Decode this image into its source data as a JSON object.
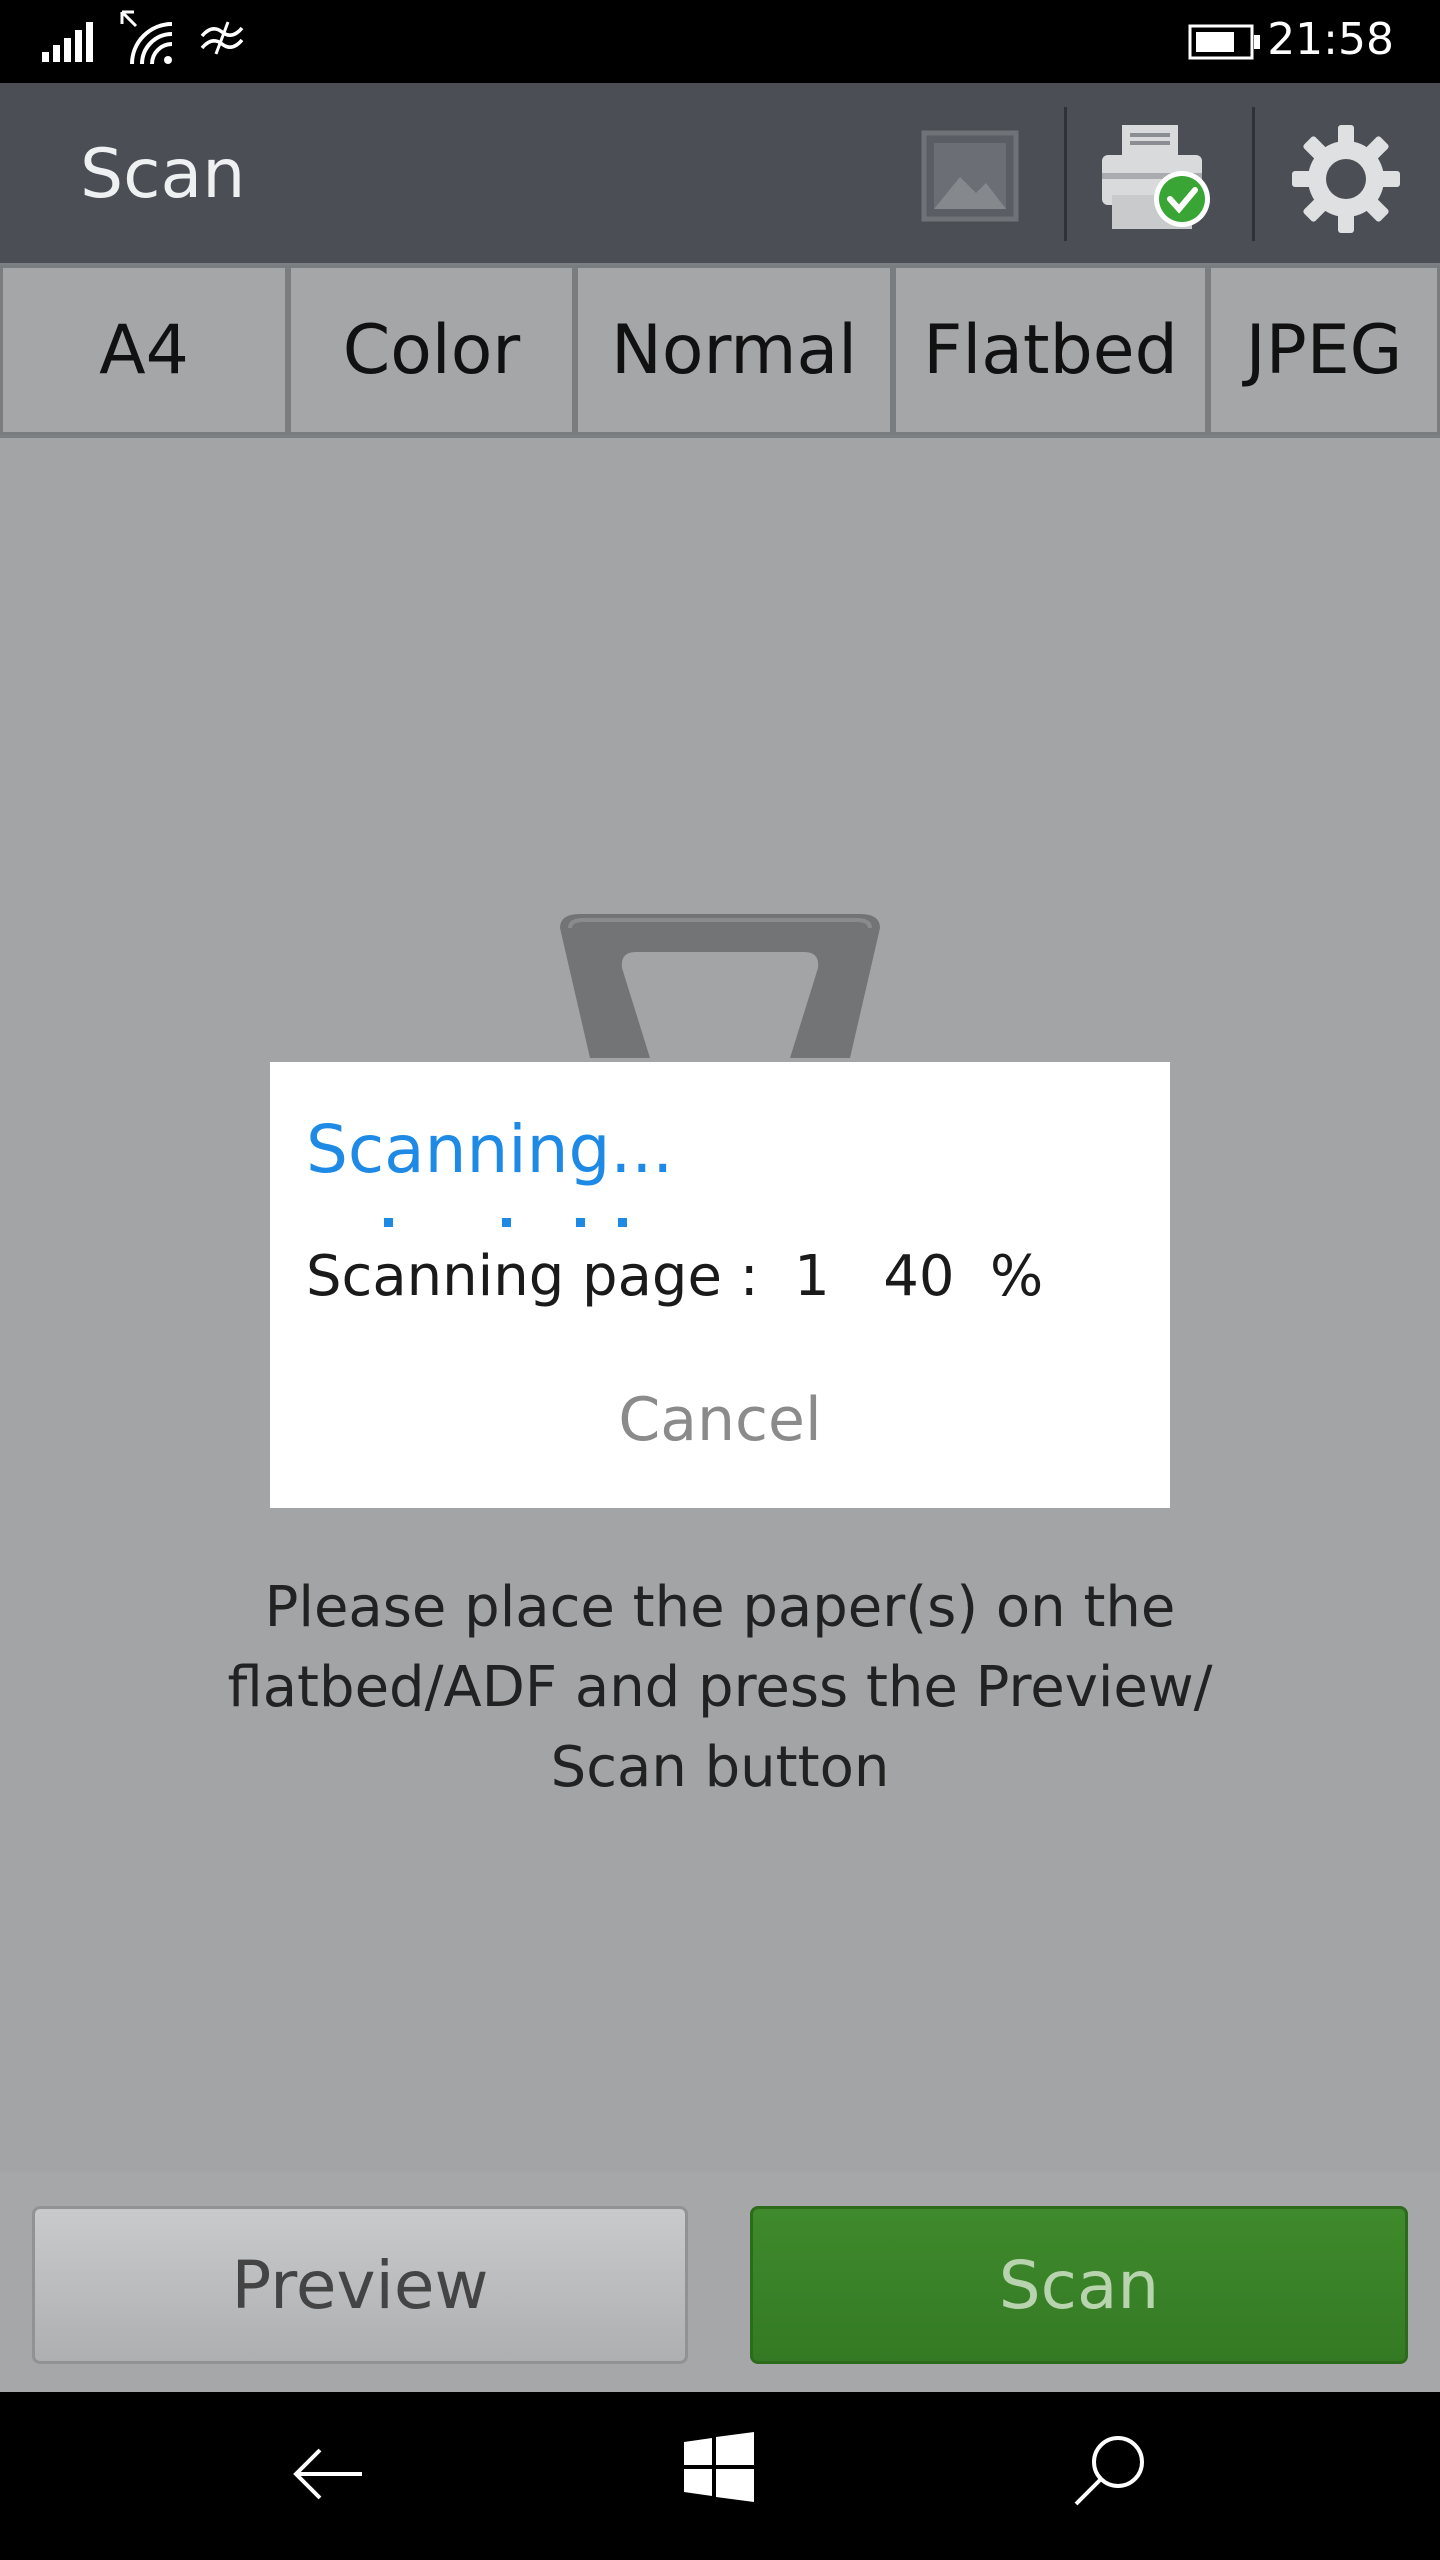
{
  "status_bar": {
    "time": "21:58",
    "icons": [
      "signal-icon",
      "wifi-icon",
      "wifi-calling-icon",
      "battery-icon"
    ]
  },
  "app_bar": {
    "title": "Scan",
    "actions": [
      "image-icon",
      "printer-status-icon",
      "gear-icon"
    ]
  },
  "scan_settings": [
    {
      "label": "A4"
    },
    {
      "label": "Color"
    },
    {
      "label": "Normal"
    },
    {
      "label": "Flatbed"
    },
    {
      "label": "JPEG"
    }
  ],
  "instructions": "Please place the paper(s) on the flatbed/ADF and press the Preview/ Scan button",
  "dialog": {
    "title": "Scanning...",
    "status_text": "Scanning page :  1   40  %",
    "page": 1,
    "progress_percent": 40,
    "cancel_label": "Cancel"
  },
  "buttons": {
    "preview_label": "Preview",
    "scan_label": "Scan"
  },
  "nav_bar": {
    "icons": [
      "back-arrow-icon",
      "windows-logo-icon",
      "search-icon"
    ]
  },
  "colors": {
    "accent": "#1e8ae6",
    "app_bar": "#4b4f55",
    "scan_button": "#3f8a2c",
    "content_background": "#a3a4a6"
  }
}
